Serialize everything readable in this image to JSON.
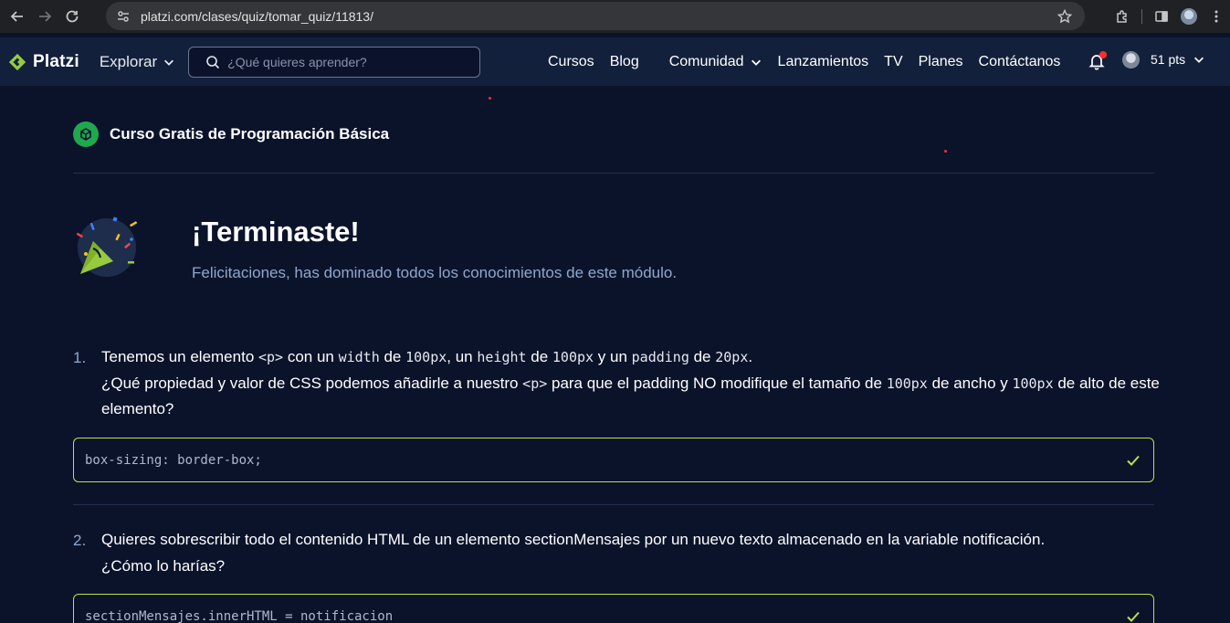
{
  "browser": {
    "url": "platzi.com/clases/quiz/tomar_quiz/11813/"
  },
  "header": {
    "logo_text": "Platzi",
    "explorar_label": "Explorar",
    "search_placeholder": "¿Qué quieres aprender?",
    "menu": {
      "cursos": "Cursos",
      "blog": "Blog",
      "comunidad": "Comunidad",
      "lanzamientos": "Lanzamientos",
      "tv": "TV",
      "planes": "Planes",
      "contactanos": "Contáctanos"
    },
    "points": "51 pts"
  },
  "course": {
    "title": "Curso Gratis de Programación Básica"
  },
  "result": {
    "title": "¡Terminaste!",
    "subtitle": "Felicitaciones, has dominado todos los conocimientos de este módulo."
  },
  "questions": [
    {
      "number": "1.",
      "parts": {
        "t1": "Tenemos un elemento ",
        "c1": "<p>",
        "t2": " con un ",
        "c2": "width",
        "t3": " de ",
        "c3": "100px",
        "t4": ", un ",
        "c4": "height",
        "t5": " de ",
        "c5": "100px",
        "t6": " y un ",
        "c6": "padding",
        "t7": " de ",
        "c7": "20px",
        "t8": ".",
        "t9": "¿Qué propiedad y valor de CSS podemos añadirle a nuestro ",
        "c9": "<p>",
        "t10": " para que el padding NO modifique el tamaño de ",
        "c10": "100px",
        "t11": " de ancho y ",
        "c11": "100px",
        "t12": " de alto de este elemento?"
      },
      "answer": "box-sizing: border-box;"
    },
    {
      "number": "2.",
      "line1": "Quieres sobrescribir todo el contenido HTML de un elemento sectionMensajes por un nuevo texto almacenado en la variable notificación.",
      "line2": "¿Cómo lo harías?",
      "answer": "sectionMensajes.innerHTML = notificacion"
    }
  ],
  "colors": {
    "background": "#0b132b",
    "header": "#13203b",
    "accent_green": "#b8e34c",
    "muted_text": "#8fa8cc"
  }
}
